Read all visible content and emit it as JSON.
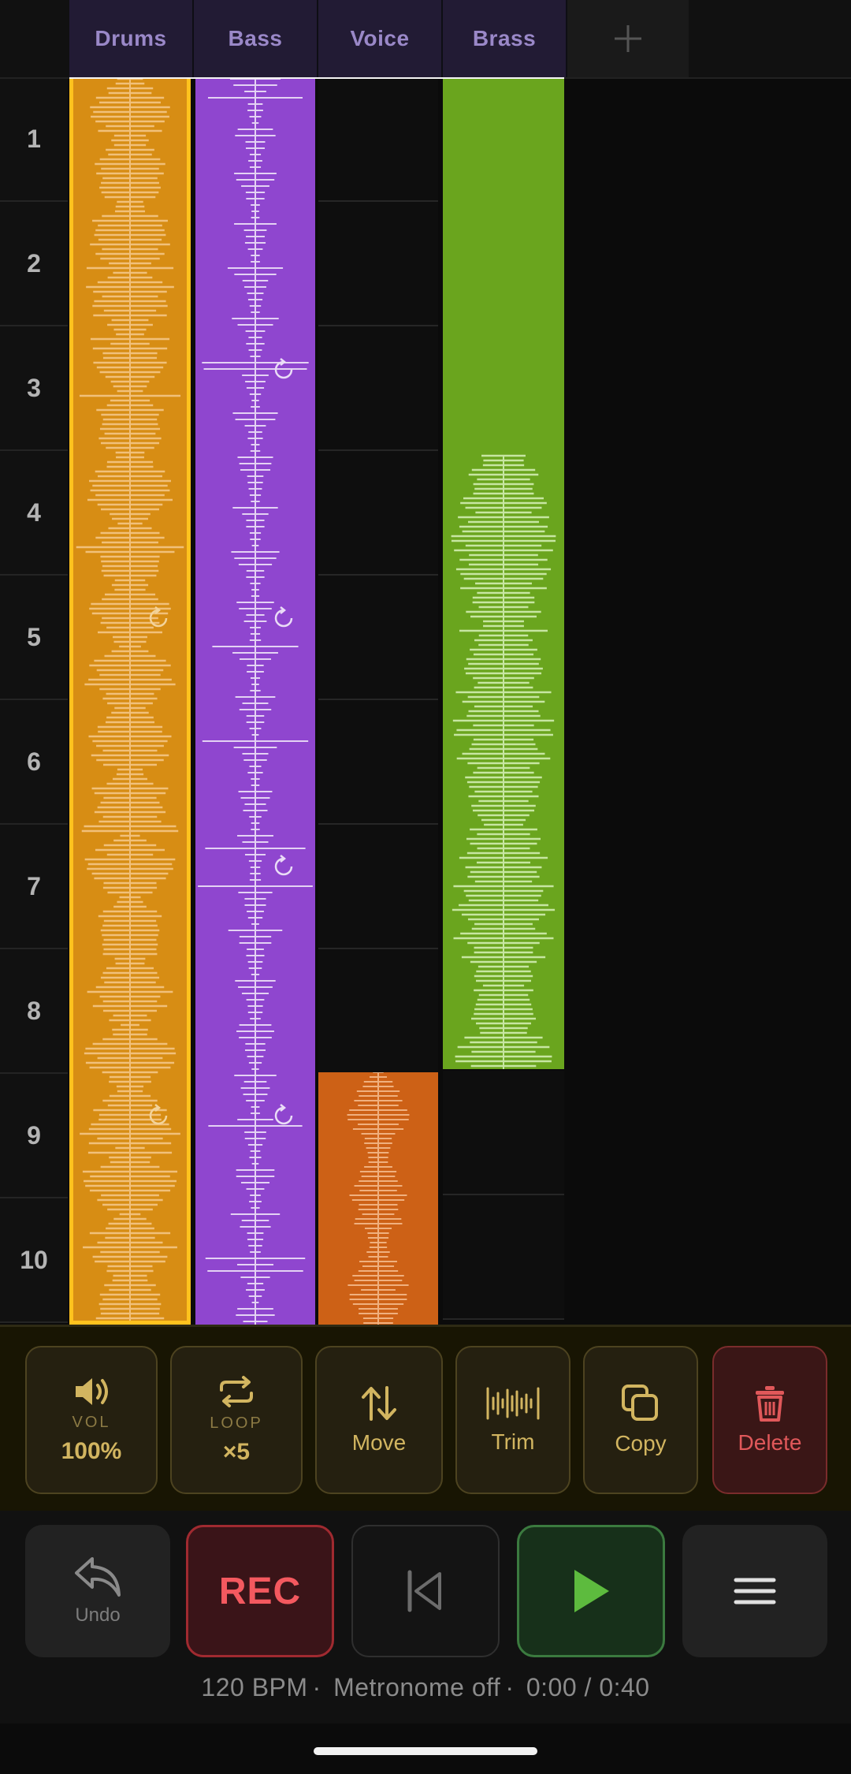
{
  "tracks": [
    {
      "name": "Drums",
      "color": "#d78d14",
      "accent": "#ffc21e"
    },
    {
      "name": "Bass",
      "color": "#8f46cf"
    },
    {
      "name": "Voice",
      "color": "#cd6116"
    },
    {
      "name": "Brass",
      "color": "#6aa51e"
    }
  ],
  "add_track_icon": "plus-icon",
  "bars": [
    "1",
    "2",
    "3",
    "4",
    "5",
    "6",
    "7",
    "8",
    "9",
    "10"
  ],
  "tools": {
    "volume": {
      "icon": "speaker-icon",
      "label": "VOL",
      "value": "100%"
    },
    "loop": {
      "icon": "loop-icon",
      "label": "LOOP",
      "value": "×5"
    },
    "move": {
      "icon": "move-arrows-icon",
      "label": "Move"
    },
    "trim": {
      "icon": "waveform-icon",
      "label": "Trim"
    },
    "copy": {
      "icon": "copy-icon",
      "label": "Copy"
    },
    "delete": {
      "icon": "trash-icon",
      "label": "Delete"
    }
  },
  "transport": {
    "undo": {
      "icon": "undo-icon",
      "label": "Undo"
    },
    "rec": {
      "label": "REC"
    },
    "rewind": {
      "icon": "skip-back-icon"
    },
    "play": {
      "icon": "play-icon"
    },
    "menu": {
      "icon": "hamburger-menu-icon"
    }
  },
  "status": {
    "bpm": "120 BPM",
    "metronome": "Metronome off",
    "time": "0:00 / 0:40"
  }
}
